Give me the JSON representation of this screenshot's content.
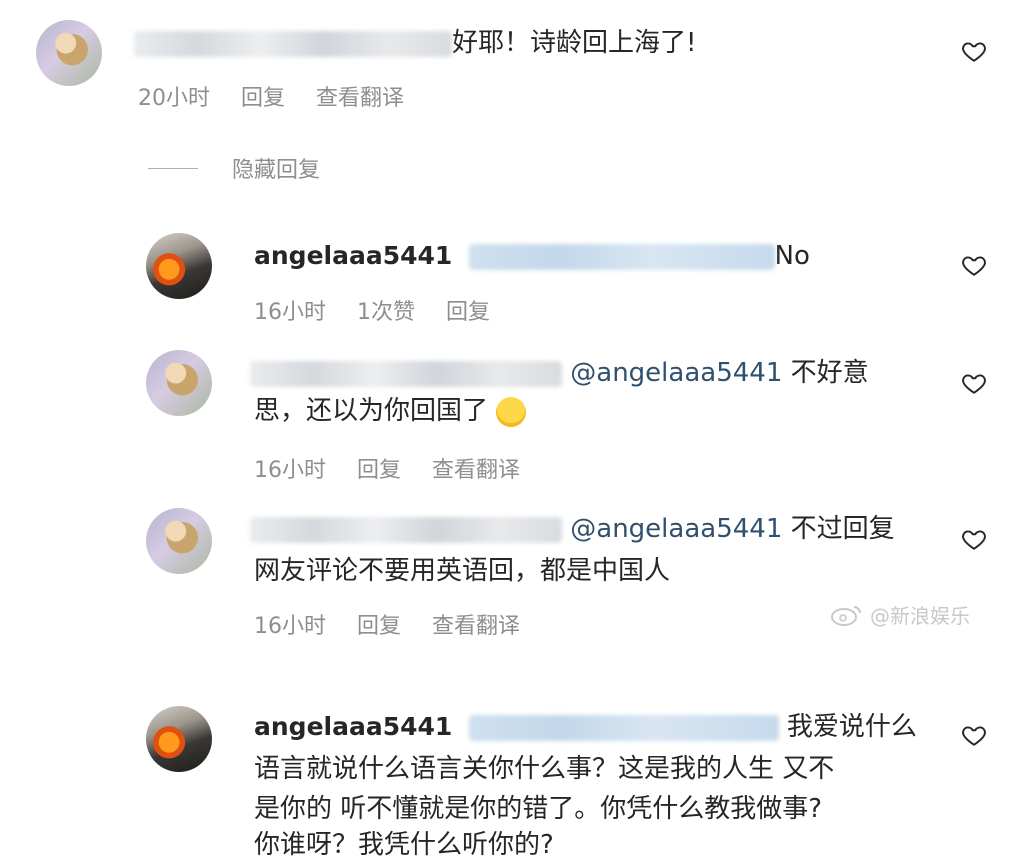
{
  "comments": [
    {
      "text": "好耶！诗龄回上海了!",
      "meta": {
        "time": "20小时",
        "reply": "回复",
        "translate": "查看翻译"
      }
    },
    {
      "username": "angelaaa5441",
      "text": "No",
      "meta": {
        "time": "16小时",
        "likes": "1次赞",
        "reply": "回复"
      }
    },
    {
      "mention": "@angelaaa5441",
      "line1": "不好意",
      "line2": "思，还以为你回国了",
      "meta": {
        "time": "16小时",
        "reply": "回复",
        "translate": "查看翻译"
      }
    },
    {
      "mention": "@angelaaa5441",
      "line1": "不过回复",
      "line2": "网友评论不要用英语回，都是中国人",
      "meta": {
        "time": "16小时",
        "reply": "回复",
        "translate": "查看翻译"
      }
    },
    {
      "username": "angelaaa5441",
      "line1": "我爱说什么",
      "line2": "语言就说什么语言关你什么事？这是我的人生 又不",
      "line3": "是你的 听不懂就是你的错了。你凭什么教我做事?",
      "line4": "你谁呀？我凭什么听你的?"
    }
  ],
  "hidden_replies": "隐藏回复",
  "watermark": "@新浪娱乐",
  "icons": {
    "like": "heart-outline-icon",
    "emoji": "laughing-tears-emoji",
    "watermark_logo": "weibo-logo-icon"
  }
}
